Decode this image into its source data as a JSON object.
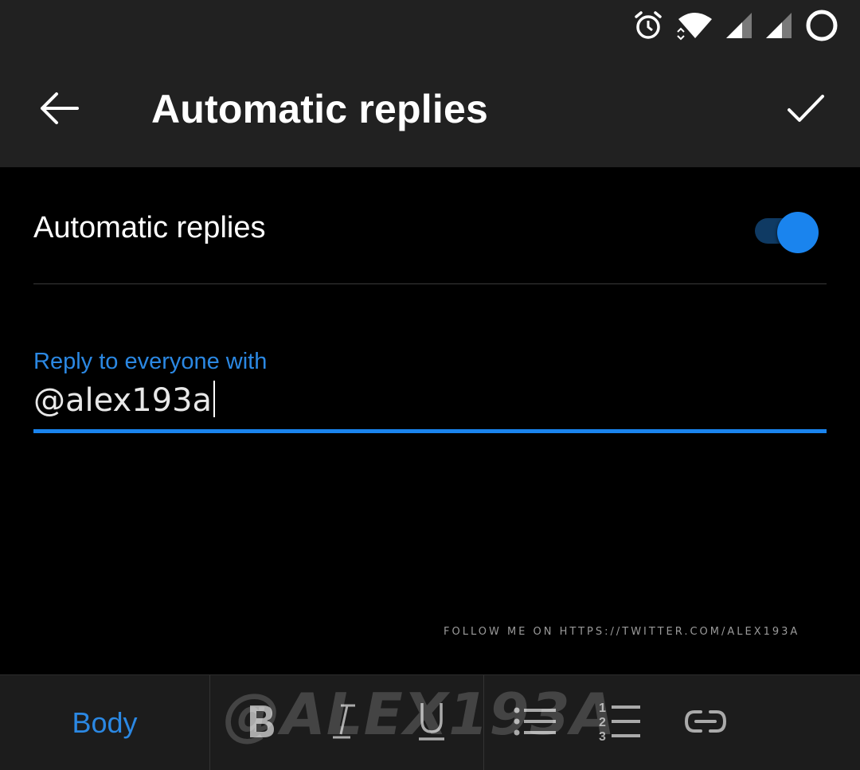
{
  "status_bar": {
    "icons": [
      "alarm-icon",
      "wifi-icon",
      "signal-1-icon",
      "signal-2-icon",
      "battery-circle-icon"
    ]
  },
  "app_bar": {
    "title": "Automatic replies",
    "back_icon": "back-arrow-icon",
    "confirm_icon": "check-icon"
  },
  "setting": {
    "label": "Automatic replies",
    "toggle_on": true,
    "accent": "#1a84ee"
  },
  "reply_field": {
    "label": "Reply to everyone with",
    "value": "@alex193a"
  },
  "overlay": {
    "follow_text": "FOLLOW ME ON HTTPS://TWITTER.COM/ALEX193A",
    "watermark": "@ALEX193A"
  },
  "toolbar": {
    "style_label": "Body",
    "buttons": [
      "bold-icon",
      "italic-icon",
      "underline-icon",
      "bulleted-list-icon",
      "numbered-list-icon",
      "link-icon"
    ]
  },
  "colors": {
    "bar_bg": "#212121",
    "accent_text": "#2b88e3"
  }
}
